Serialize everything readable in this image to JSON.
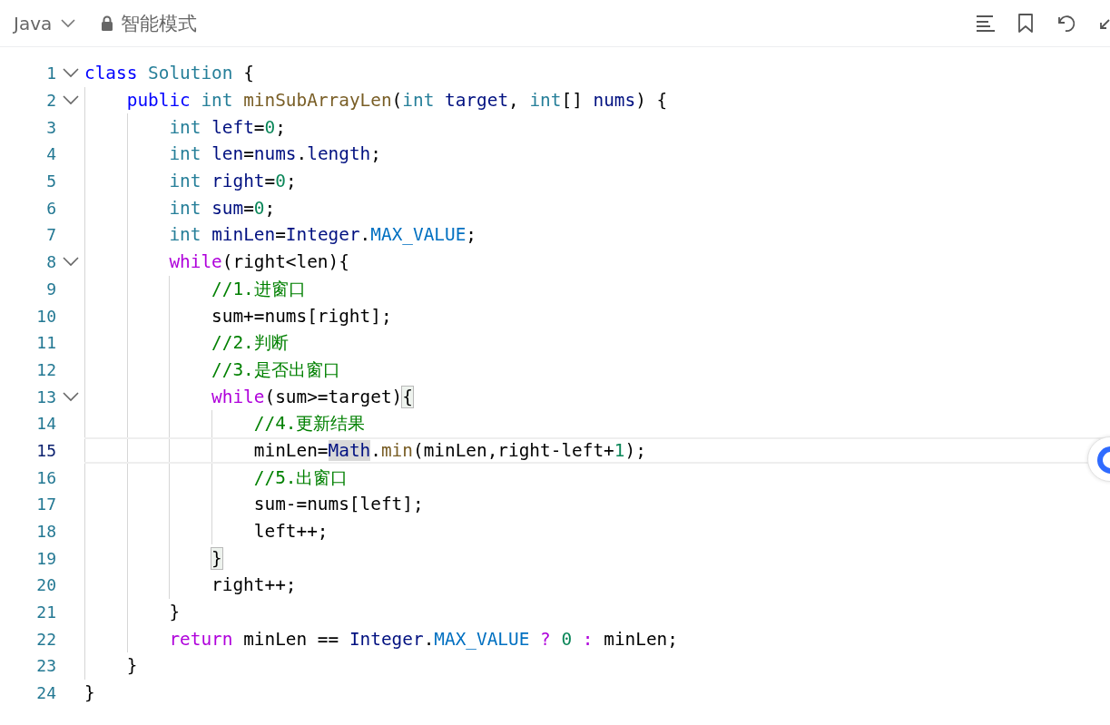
{
  "toolbar": {
    "language": "Java",
    "mode": "智能模式"
  },
  "lines": [
    {
      "number": "1",
      "fold_marker": true,
      "current": false,
      "tokens": [
        {
          "text": "class",
          "kind": "keyword"
        },
        {
          "text": " Solution",
          "kind": "type"
        },
        {
          "text": " {",
          "kind": "plain"
        }
      ]
    },
    {
      "number": "2",
      "fold_marker": true,
      "current": false,
      "tokens": [
        {
          "text": "    public",
          "kind": "keyword"
        },
        {
          "text": " int",
          "kind": "type"
        },
        {
          "text": " minSubArrayLen",
          "kind": "function"
        },
        {
          "text": "(",
          "kind": "plain"
        },
        {
          "text": "int",
          "kind": "type"
        },
        {
          "text": " target",
          "kind": "variable"
        },
        {
          "text": ", ",
          "kind": "plain"
        },
        {
          "text": "int",
          "kind": "type"
        },
        {
          "text": "[] ",
          "kind": "plain"
        },
        {
          "text": "nums",
          "kind": "variable"
        },
        {
          "text": ") {",
          "kind": "plain"
        }
      ]
    },
    {
      "number": "3",
      "fold_marker": false,
      "current": false,
      "tokens": [
        {
          "text": "        int",
          "kind": "type"
        },
        {
          "text": " left",
          "kind": "variable"
        },
        {
          "text": "=",
          "kind": "plain"
        },
        {
          "text": "0",
          "kind": "number"
        },
        {
          "text": ";",
          "kind": "plain"
        }
      ]
    },
    {
      "number": "4",
      "fold_marker": false,
      "current": false,
      "tokens": [
        {
          "text": "        int",
          "kind": "type"
        },
        {
          "text": " len",
          "kind": "variable"
        },
        {
          "text": "=",
          "kind": "plain"
        },
        {
          "text": "nums",
          "kind": "variable"
        },
        {
          "text": ".",
          "kind": "plain"
        },
        {
          "text": "length",
          "kind": "variable"
        },
        {
          "text": ";",
          "kind": "plain"
        }
      ]
    },
    {
      "number": "5",
      "fold_marker": false,
      "current": false,
      "tokens": [
        {
          "text": "        int",
          "kind": "type"
        },
        {
          "text": " right",
          "kind": "variable"
        },
        {
          "text": "=",
          "kind": "plain"
        },
        {
          "text": "0",
          "kind": "number"
        },
        {
          "text": ";",
          "kind": "plain"
        }
      ]
    },
    {
      "number": "6",
      "fold_marker": false,
      "current": false,
      "tokens": [
        {
          "text": "        int",
          "kind": "type"
        },
        {
          "text": " sum",
          "kind": "variable"
        },
        {
          "text": "=",
          "kind": "plain"
        },
        {
          "text": "0",
          "kind": "number"
        },
        {
          "text": ";",
          "kind": "plain"
        }
      ]
    },
    {
      "number": "7",
      "fold_marker": false,
      "current": false,
      "tokens": [
        {
          "text": "        int",
          "kind": "type"
        },
        {
          "text": " minLen",
          "kind": "variable"
        },
        {
          "text": "=",
          "kind": "plain"
        },
        {
          "text": "Integer",
          "kind": "variable"
        },
        {
          "text": ".",
          "kind": "plain"
        },
        {
          "text": "MAX_VALUE",
          "kind": "constant"
        },
        {
          "text": ";",
          "kind": "plain"
        }
      ]
    },
    {
      "number": "8",
      "fold_marker": true,
      "current": false,
      "tokens": [
        {
          "text": "        while",
          "kind": "control"
        },
        {
          "text": "(right<len){",
          "kind": "plain"
        }
      ]
    },
    {
      "number": "9",
      "fold_marker": false,
      "current": false,
      "tokens": [
        {
          "text": "            //1.进窗口",
          "kind": "comment"
        }
      ]
    },
    {
      "number": "10",
      "fold_marker": false,
      "current": false,
      "tokens": [
        {
          "text": "            sum+=nums[right];",
          "kind": "plain"
        }
      ]
    },
    {
      "number": "11",
      "fold_marker": false,
      "current": false,
      "tokens": [
        {
          "text": "            //2.判断",
          "kind": "comment"
        }
      ]
    },
    {
      "number": "12",
      "fold_marker": false,
      "current": false,
      "tokens": [
        {
          "text": "            //3.是否出窗口",
          "kind": "comment"
        }
      ]
    },
    {
      "number": "13",
      "fold_marker": true,
      "current": false,
      "tokens": [
        {
          "text": "            while",
          "kind": "control"
        },
        {
          "text": "(sum>=target)",
          "kind": "plain"
        },
        {
          "text": "{",
          "kind": "bracket-match"
        }
      ]
    },
    {
      "number": "14",
      "fold_marker": false,
      "current": false,
      "tokens": [
        {
          "text": "                //4.更新结果",
          "kind": "comment"
        }
      ]
    },
    {
      "number": "15",
      "fold_marker": false,
      "current": true,
      "tokens": [
        {
          "text": "                minLen=",
          "kind": "plain"
        },
        {
          "text": "Math",
          "kind": "selection"
        },
        {
          "text": ".",
          "kind": "plain"
        },
        {
          "text": "min",
          "kind": "function"
        },
        {
          "text": "(minLen,right-left+",
          "kind": "plain"
        },
        {
          "text": "1",
          "kind": "number"
        },
        {
          "text": ");",
          "kind": "plain"
        }
      ]
    },
    {
      "number": "16",
      "fold_marker": false,
      "current": false,
      "tokens": [
        {
          "text": "                //5.出窗口",
          "kind": "comment"
        }
      ]
    },
    {
      "number": "17",
      "fold_marker": false,
      "current": false,
      "tokens": [
        {
          "text": "                sum-=nums[left];",
          "kind": "plain"
        }
      ]
    },
    {
      "number": "18",
      "fold_marker": false,
      "current": false,
      "tokens": [
        {
          "text": "                left++;",
          "kind": "plain"
        }
      ]
    },
    {
      "number": "19",
      "fold_marker": false,
      "current": false,
      "tokens": [
        {
          "text": "            }",
          "kind": "bracket-match"
        }
      ]
    },
    {
      "number": "20",
      "fold_marker": false,
      "current": false,
      "tokens": [
        {
          "text": "            right++;",
          "kind": "plain"
        }
      ]
    },
    {
      "number": "21",
      "fold_marker": false,
      "current": false,
      "tokens": [
        {
          "text": "        }",
          "kind": "plain"
        }
      ]
    },
    {
      "number": "22",
      "fold_marker": false,
      "current": false,
      "tokens": [
        {
          "text": "        return",
          "kind": "control"
        },
        {
          "text": " minLen == ",
          "kind": "plain"
        },
        {
          "text": "Integer",
          "kind": "variable"
        },
        {
          "text": ".",
          "kind": "plain"
        },
        {
          "text": "MAX_VALUE",
          "kind": "constant"
        },
        {
          "text": " ?",
          "kind": "control"
        },
        {
          "text": " 0",
          "kind": "number"
        },
        {
          "text": " :",
          "kind": "control"
        },
        {
          "text": " minLen;",
          "kind": "plain"
        }
      ]
    },
    {
      "number": "23",
      "fold_marker": false,
      "current": false,
      "tokens": [
        {
          "text": "    }",
          "kind": "plain"
        }
      ]
    },
    {
      "number": "24",
      "fold_marker": false,
      "current": false,
      "tokens": [
        {
          "text": "}",
          "kind": "plain"
        }
      ]
    }
  ]
}
